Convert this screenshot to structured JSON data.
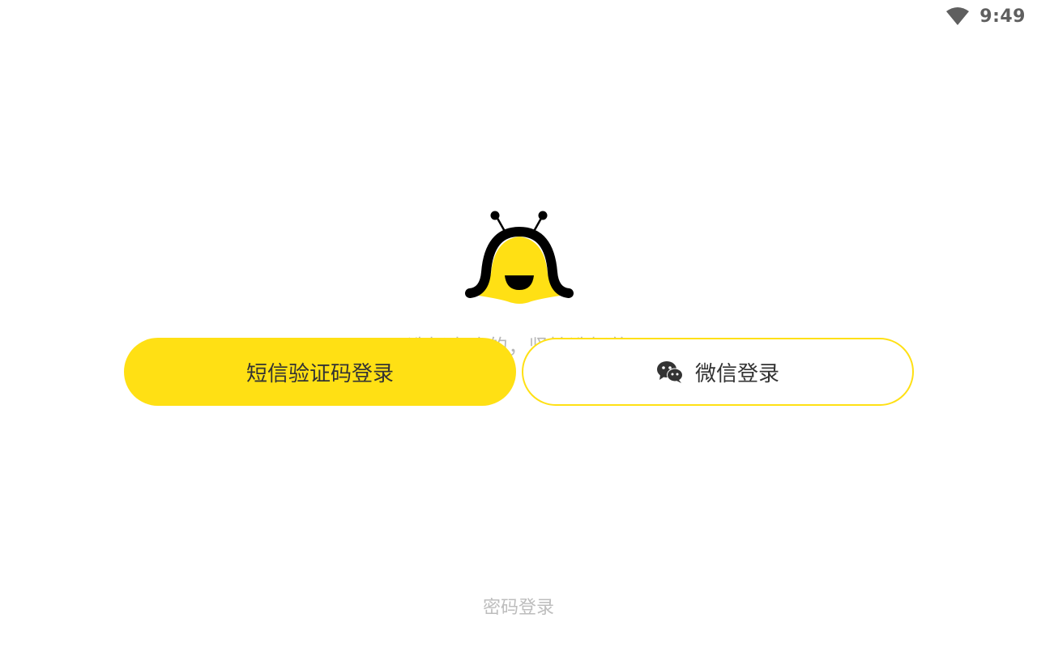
{
  "status_bar": {
    "time": "9:49",
    "wifi_icon": "wifi-icon"
  },
  "logo": {
    "icon": "bee-logo-icon",
    "colors": {
      "body": "#ffe014",
      "outline": "#000000"
    }
  },
  "tagline": "选择喜欢的，坚持选择的",
  "buttons": {
    "sms_login_label": "短信验证码登录",
    "wechat_login_label": "微信登录",
    "wechat_icon": "wechat-icon"
  },
  "password_login_label": "密码登录",
  "colors": {
    "accent": "#ffe014",
    "text_primary": "#333333",
    "text_muted": "#bdbdbd"
  }
}
